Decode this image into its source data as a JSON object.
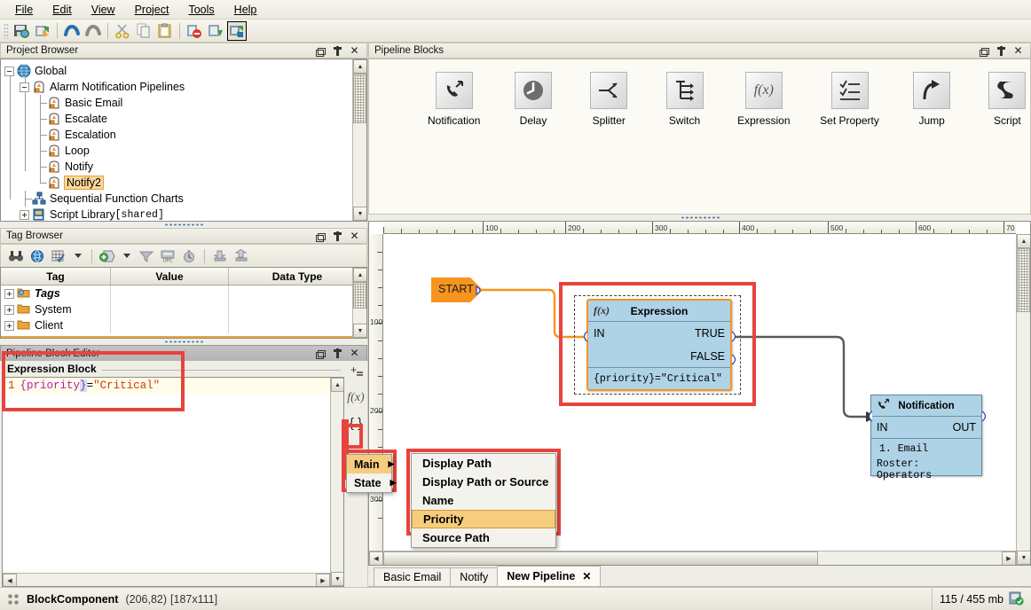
{
  "menubar": {
    "items": [
      {
        "label": "File",
        "mnemonic": "F"
      },
      {
        "label": "Edit",
        "mnemonic": "E"
      },
      {
        "label": "View",
        "mnemonic": "V"
      },
      {
        "label": "Project",
        "mnemonic": "P"
      },
      {
        "label": "Tools",
        "mnemonic": "T"
      },
      {
        "label": "Help",
        "mnemonic": "H"
      }
    ]
  },
  "toolbar": {
    "buttons": [
      {
        "name": "save-icon"
      },
      {
        "name": "refresh-icon"
      },
      {
        "name": "undo-icon"
      },
      {
        "name": "redo-icon"
      },
      {
        "name": "cut-icon"
      },
      {
        "name": "copy-icon"
      },
      {
        "name": "paste-icon"
      },
      {
        "name": "disconnect-icon"
      },
      {
        "name": "download-icon"
      },
      {
        "name": "update-icon"
      }
    ]
  },
  "project_browser": {
    "title": "Project Browser",
    "tree": [
      {
        "label": "Global",
        "icon": "globe-icon",
        "toggle": "minus",
        "depth": 0
      },
      {
        "label": "Alarm Notification Pipelines",
        "icon": "pipeline-icon",
        "toggle": "minus",
        "depth": 1
      },
      {
        "label": "Basic Email",
        "icon": "pipeline-icon",
        "toggle": "none",
        "depth": 2
      },
      {
        "label": "Escalate",
        "icon": "pipeline-icon",
        "toggle": "none",
        "depth": 2
      },
      {
        "label": "Escalation",
        "icon": "pipeline-icon",
        "toggle": "none",
        "depth": 2
      },
      {
        "label": "Loop",
        "icon": "pipeline-icon",
        "toggle": "none",
        "depth": 2
      },
      {
        "label": "Notify",
        "icon": "pipeline-icon",
        "toggle": "none",
        "depth": 2
      },
      {
        "label": "Notify2",
        "icon": "pipeline-icon",
        "toggle": "none",
        "depth": 2,
        "selected": true
      },
      {
        "label": "Sequential Function Charts",
        "icon": "sfc-icon",
        "toggle": "none",
        "depth": 1
      },
      {
        "label": "Script Library ",
        "suffix": "[shared]",
        "icon": "script-icon",
        "toggle": "plus",
        "depth": 1
      }
    ]
  },
  "tag_browser": {
    "title": "Tag Browser",
    "toolbar_icons": [
      "binoculars-icon",
      "tag-browse-icon",
      "tag-edit-icon",
      "dropdown-caret-icon",
      "new-tag-icon",
      "new-tag-caret-icon",
      "filter-icon",
      "opc-icon",
      "history-icon",
      "import-icon",
      "export-icon"
    ],
    "columns": [
      "Tag",
      "Value",
      "Data Type"
    ],
    "rows": [
      {
        "tag": "Tags",
        "value": "",
        "data_type": "",
        "icon": "tags-folder-icon",
        "italic": true
      },
      {
        "tag": "System",
        "value": "",
        "data_type": "",
        "icon": "folder-icon"
      },
      {
        "tag": "Client",
        "value": "",
        "data_type": "",
        "icon": "folder-icon"
      }
    ]
  },
  "block_editor": {
    "title": "Pipeline Block Editor",
    "group_title": "Expression Block",
    "code": {
      "line_number": "1",
      "brace_open": "{",
      "variable": "priority",
      "brace_close": "}",
      "operator": "=",
      "string": "\"Critical\""
    },
    "side_buttons": [
      {
        "name": "insert-property-icon",
        "glyph": "+"
      },
      {
        "name": "function-icon",
        "glyph": "f(x)"
      },
      {
        "name": "braces-icon",
        "glyph": "{ }"
      }
    ]
  },
  "pipeline_blocks": {
    "title": "Pipeline Blocks",
    "items": [
      {
        "label": "Notification",
        "icon": "notification-icon"
      },
      {
        "label": "Delay",
        "icon": "delay-icon"
      },
      {
        "label": "Splitter",
        "icon": "splitter-icon"
      },
      {
        "label": "Switch",
        "icon": "switch-icon"
      },
      {
        "label": "Expression",
        "icon": "expression-icon"
      },
      {
        "label": "Set Property",
        "icon": "set-property-icon"
      },
      {
        "label": "Jump",
        "icon": "jump-icon"
      },
      {
        "label": "Script",
        "icon": "script-block-icon"
      }
    ]
  },
  "canvas": {
    "ruler_h_labels": [
      "100",
      "200",
      "300",
      "400",
      "500",
      "600",
      "70"
    ],
    "ruler_v_labels": [
      "100",
      "200",
      "300"
    ],
    "start_node": {
      "label": "START"
    },
    "expression_block": {
      "title": "Expression",
      "icon": "fx-icon",
      "input": "IN",
      "outputs": [
        "TRUE",
        "FALSE"
      ],
      "expression": "{priority}=\"Critical\""
    },
    "notification_block": {
      "title": "Notification",
      "icon": "notification-icon",
      "input": "IN",
      "output": "OUT",
      "line1": "1. Email",
      "line2": "Roster: Operators"
    }
  },
  "context_menu": {
    "groups": [
      {
        "label": "Main",
        "highlighted": true,
        "has_submenu": true
      },
      {
        "label": "State",
        "highlighted": false,
        "has_submenu": true
      }
    ],
    "submenu": [
      {
        "label": "Display Path",
        "highlighted": false
      },
      {
        "label": "Display Path or Source",
        "highlighted": false
      },
      {
        "label": "Name",
        "highlighted": false
      },
      {
        "label": "Priority",
        "highlighted": true
      },
      {
        "label": "Source Path",
        "highlighted": false
      }
    ]
  },
  "tabs": {
    "items": [
      {
        "label": "Basic Email",
        "active": false,
        "closable": false
      },
      {
        "label": "Notify",
        "active": false,
        "closable": false
      },
      {
        "label": "New Pipeline",
        "active": true,
        "closable": true,
        "close_glyph": "✕"
      }
    ]
  },
  "statusbar": {
    "component": "BlockComponent",
    "coords": "(206,82)",
    "size": "[187x111]",
    "memory": "115 / 455 mb",
    "memory_icon": "memory-ok-icon",
    "left_icon": "grid-icon"
  },
  "colors": {
    "accent_orange": "#f7941e",
    "highlight_red": "#e8433c",
    "block_blue": "#aed2e6",
    "menu_highlight": "#f6cd7e",
    "code_bg": "#fffde8"
  }
}
